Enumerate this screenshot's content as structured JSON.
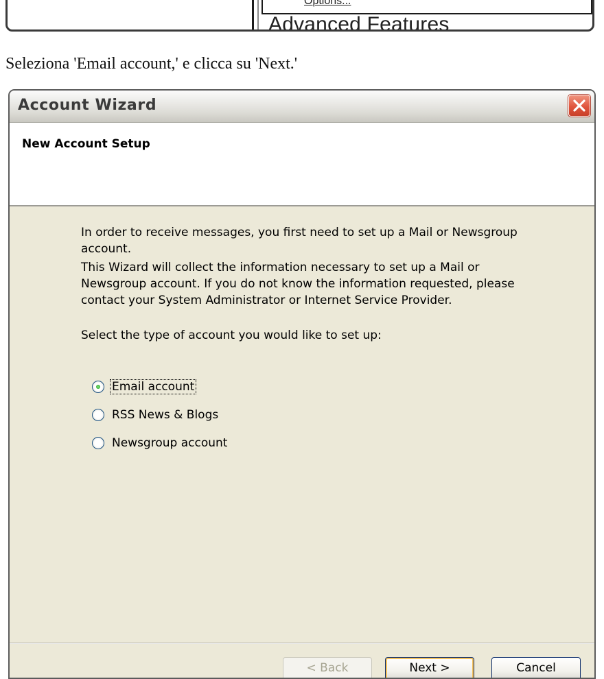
{
  "top_fragment": {
    "menu_item": "Options...",
    "section_heading": "Advanced Features"
  },
  "caption": "Seleziona 'Email account,' e clicca su 'Next.'",
  "wizard": {
    "title": "Account Wizard",
    "header_title": "New Account Setup",
    "paragraphs": [
      "In order to receive messages, you first need to set up a Mail or Newsgroup account.",
      "This Wizard will collect the information necessary to set up a Mail or Newsgroup account. If you do not know the information requested, please contact your System Administrator or Internet Service Provider.",
      "Select the type of account you would like to set up:"
    ],
    "options": [
      {
        "label": "Email account",
        "selected": true
      },
      {
        "label": "RSS News & Blogs",
        "selected": false
      },
      {
        "label": "Newsgroup account",
        "selected": false
      }
    ],
    "buttons": {
      "back": "< Back",
      "next": "Next >",
      "cancel": "Cancel"
    }
  },
  "colors": {
    "dialog_bg": "#ece9d8",
    "close_button": "#e0553e",
    "radio_dot": "#21a121",
    "default_button_ring": "#f5c25c"
  }
}
